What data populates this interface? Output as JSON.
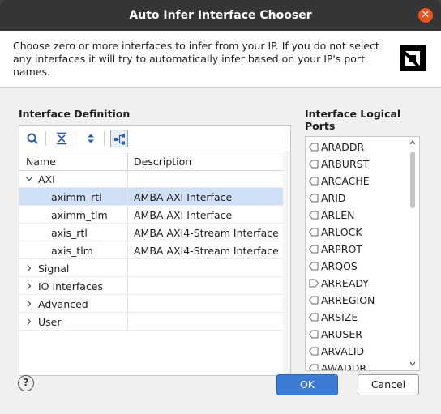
{
  "window": {
    "title": "Auto Infer Interface Chooser",
    "close_glyph": "✕"
  },
  "banner": {
    "description": "Choose zero or more interfaces to infer from your IP. If you do not select any interfaces it will try to automatically infer based on your IP's port names.",
    "logo_icon": "amd-logo-icon"
  },
  "interface_definition": {
    "label": "Interface Definition",
    "toolbar": [
      {
        "icon": "search-icon"
      },
      {
        "icon": "collapse-all-icon"
      },
      {
        "icon": "expand-all-icon"
      },
      {
        "icon": "hierarchy-icon",
        "active": true
      }
    ],
    "columns": [
      "Name",
      "Description"
    ],
    "rows": [
      {
        "name": "AXI",
        "description": "",
        "level": 0,
        "expanded": true
      },
      {
        "name": "aximm_rtl",
        "description": "AMBA AXI Interface",
        "level": 1,
        "selected": true
      },
      {
        "name": "aximm_tlm",
        "description": "AMBA AXI Interface",
        "level": 1
      },
      {
        "name": "axis_rtl",
        "description": "AMBA AXI4-Stream Interface",
        "level": 1
      },
      {
        "name": "axis_tlm",
        "description": "AMBA AXI4-Stream Interface",
        "level": 1
      },
      {
        "name": "Signal",
        "description": "",
        "level": 0,
        "expanded": false
      },
      {
        "name": "IO Interfaces",
        "description": "",
        "level": 0,
        "expanded": false
      },
      {
        "name": "Advanced",
        "description": "",
        "level": 0,
        "expanded": false
      },
      {
        "name": "User",
        "description": "",
        "level": 0,
        "expanded": false
      }
    ]
  },
  "logical_ports": {
    "label_line1": "Interface Logical",
    "label_line2": "Ports",
    "ports": [
      {
        "name": "ARADDR",
        "direction": "out"
      },
      {
        "name": "ARBURST",
        "direction": "out"
      },
      {
        "name": "ARCACHE",
        "direction": "out"
      },
      {
        "name": "ARID",
        "direction": "out"
      },
      {
        "name": "ARLEN",
        "direction": "out"
      },
      {
        "name": "ARLOCK",
        "direction": "out"
      },
      {
        "name": "ARPROT",
        "direction": "out"
      },
      {
        "name": "ARQOS",
        "direction": "out"
      },
      {
        "name": "ARREADY",
        "direction": "in"
      },
      {
        "name": "ARREGION",
        "direction": "out"
      },
      {
        "name": "ARSIZE",
        "direction": "out"
      },
      {
        "name": "ARUSER",
        "direction": "out"
      },
      {
        "name": "ARVALID",
        "direction": "out"
      },
      {
        "name": "AWADDR",
        "direction": "out"
      }
    ]
  },
  "footer": {
    "help_label": "?",
    "ok_label": "OK",
    "cancel_label": "Cancel"
  },
  "colors": {
    "accent": "#3d7cd6",
    "selection": "#cfe0f7",
    "titlebar": "#353535",
    "close": "#e95420"
  }
}
